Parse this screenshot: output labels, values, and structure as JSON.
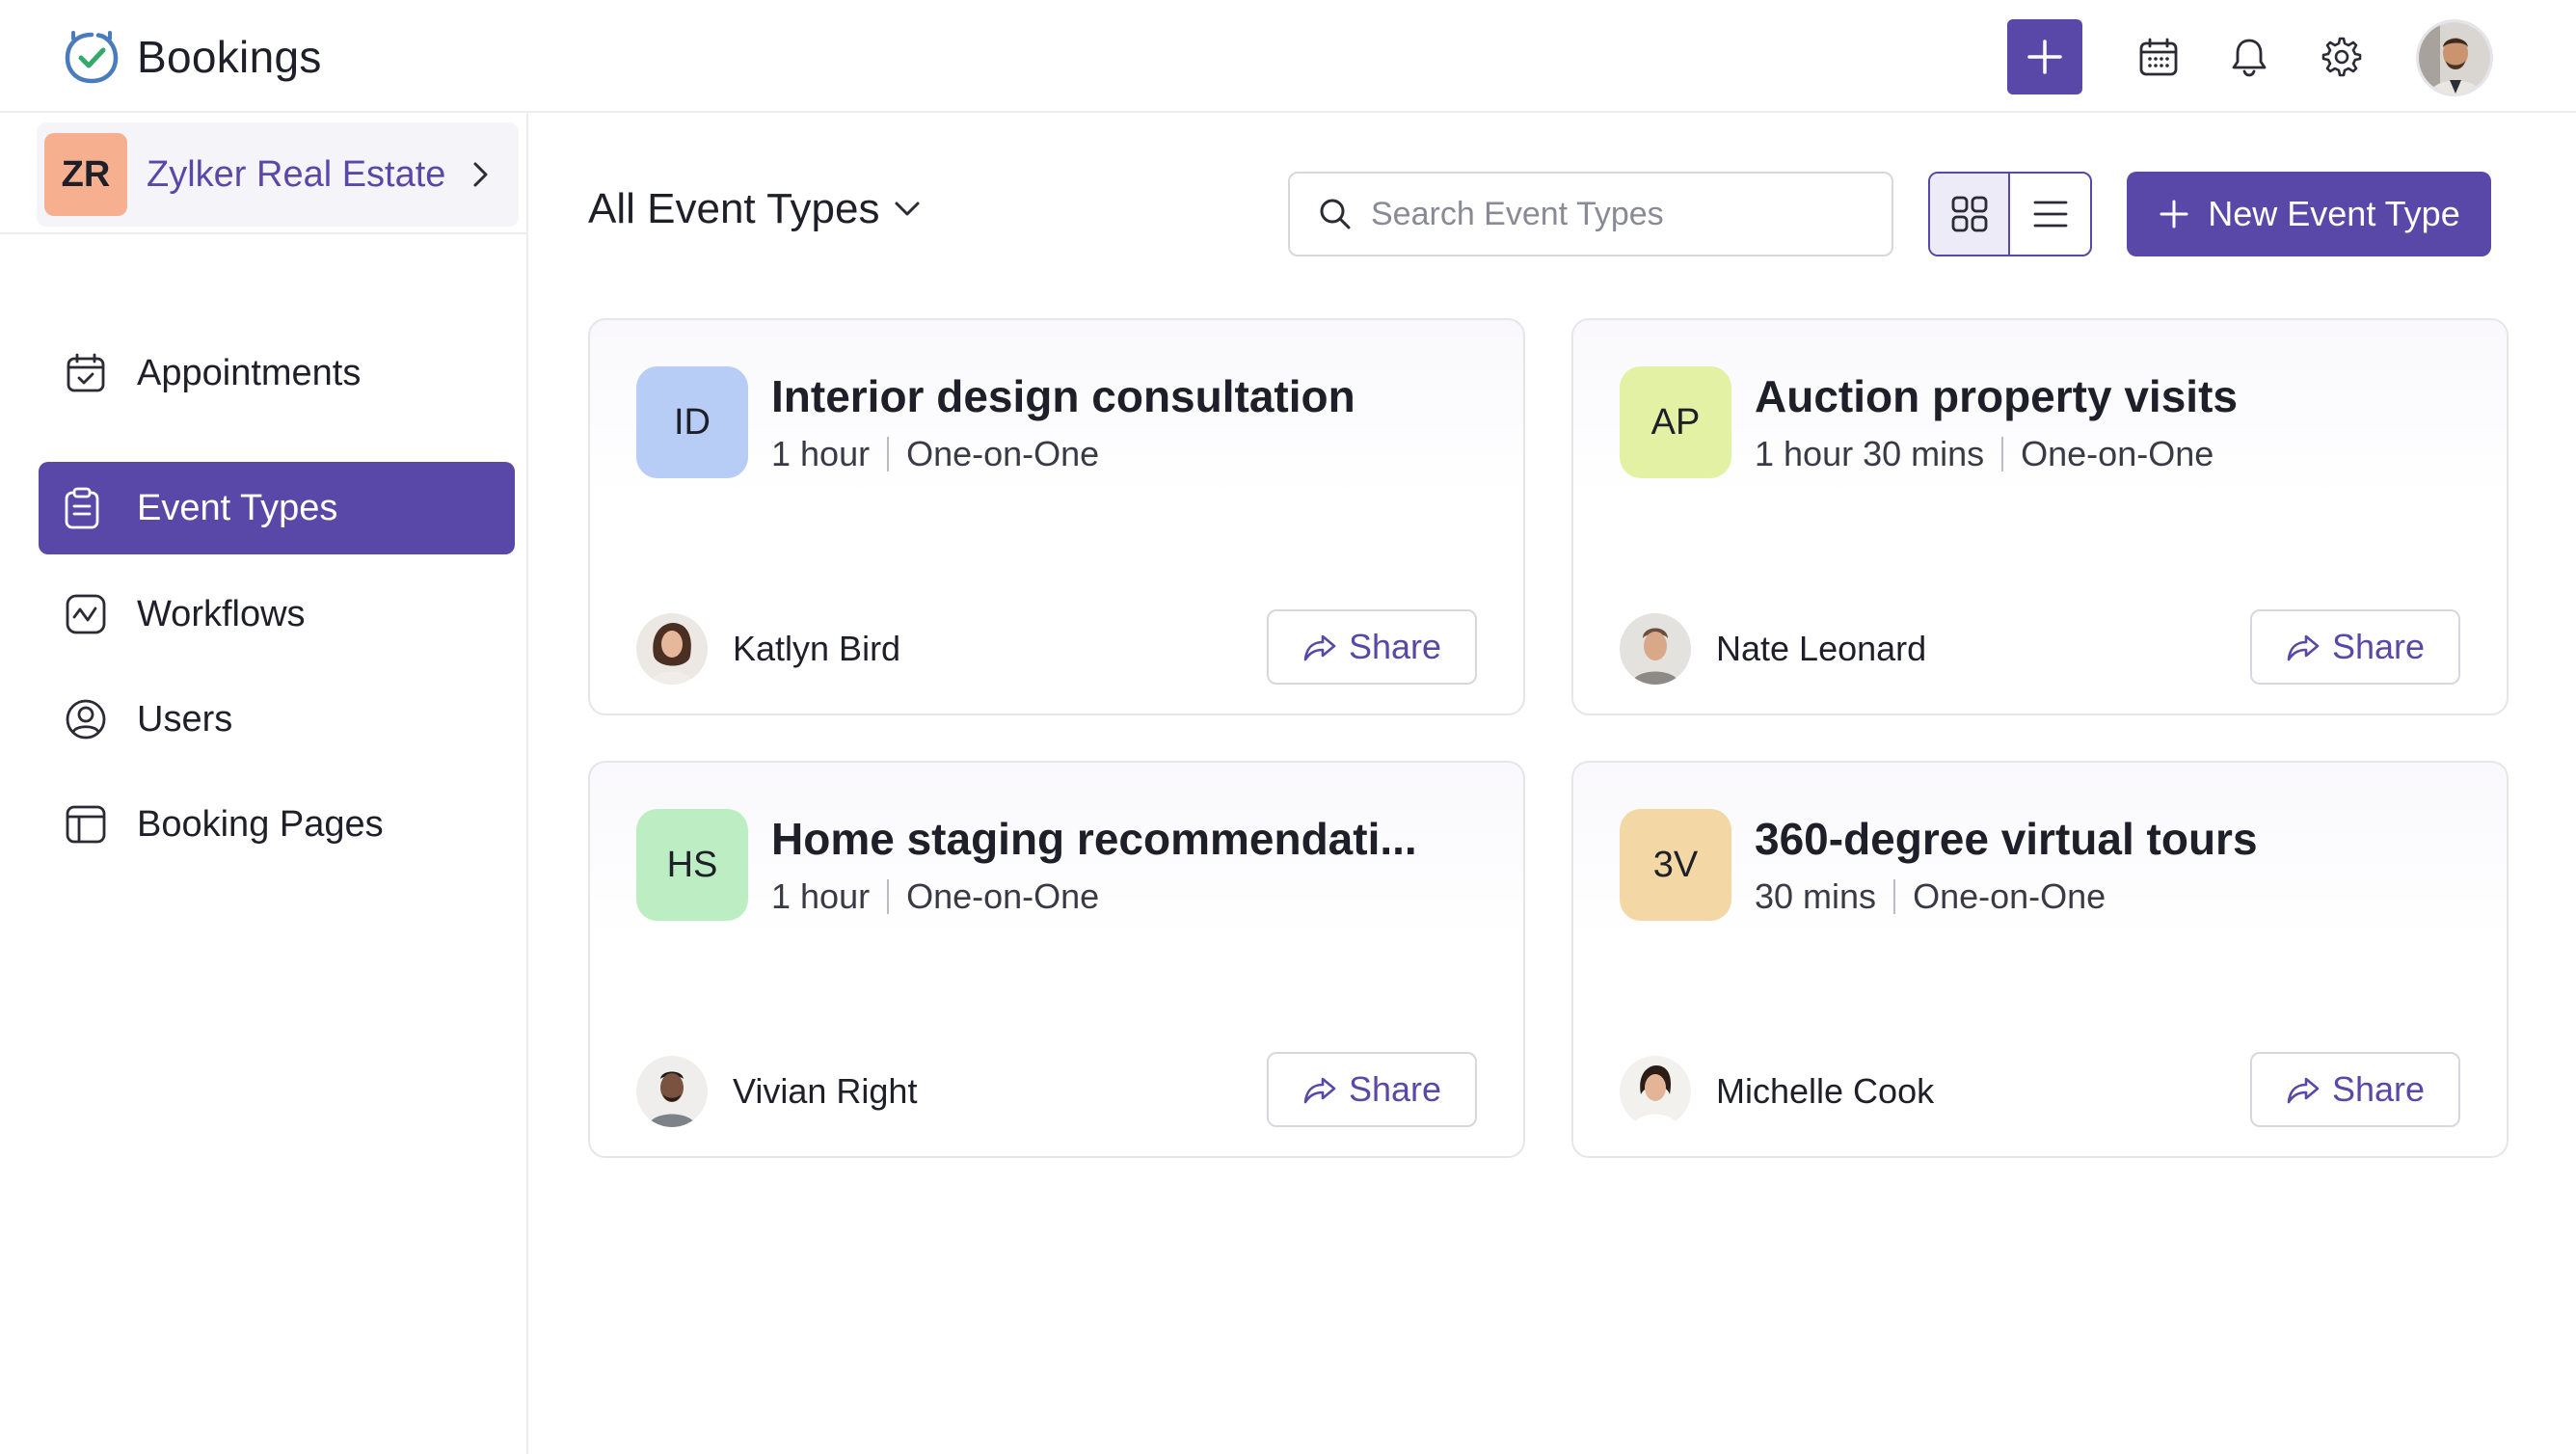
{
  "app": {
    "title": "Bookings",
    "top_actions": [
      "add-icon",
      "calendar-icon",
      "bell-icon",
      "gear-icon",
      "avatar"
    ]
  },
  "sidebar": {
    "org": {
      "initials": "ZR",
      "name": "Zylker Real Estate",
      "badge_color": "#f6b08f"
    },
    "items": [
      {
        "label": "Appointments",
        "icon": "calendar-check-icon"
      },
      {
        "label": "Event Types",
        "icon": "clipboard-icon",
        "active": true
      },
      {
        "label": "Workflows",
        "icon": "workflow-icon"
      },
      {
        "label": "Users",
        "icon": "user-circle-icon"
      },
      {
        "label": "Booking Pages",
        "icon": "booking-page-icon"
      }
    ]
  },
  "main": {
    "filter_label": "All Event Types",
    "search_placeholder": "Search Event Types",
    "view_modes": [
      "grid",
      "list"
    ],
    "active_view": "grid",
    "new_button_label": "New Event Type"
  },
  "events": [
    {
      "initials": "ID",
      "title": "Interior design consultation",
      "duration": "1 hour",
      "type": "One-on-One",
      "owner": "Katlyn Bird",
      "share_label": "Share",
      "badge_color": "#b7cdf5"
    },
    {
      "initials": "AP",
      "title": "Auction property visits",
      "duration": "1 hour 30 mins",
      "type": "One-on-One",
      "owner": "Nate Leonard",
      "share_label": "Share",
      "badge_color": "#e3f1a4"
    },
    {
      "initials": "HS",
      "title": "Home staging recommendati...",
      "duration": "1 hour",
      "type": "One-on-One",
      "owner": "Vivian Right",
      "share_label": "Share",
      "badge_color": "#bdeec3"
    },
    {
      "initials": "3V",
      "title": "360-degree virtual tours",
      "duration": "30 mins",
      "type": "One-on-One",
      "owner": "Michelle Cook",
      "share_label": "Share",
      "badge_color": "#f3d7a4"
    }
  ],
  "colors": {
    "accent": "#5a48a8",
    "active_nav_bg": "#5a48a8",
    "toggle_active_bg": "#ecebf7"
  }
}
